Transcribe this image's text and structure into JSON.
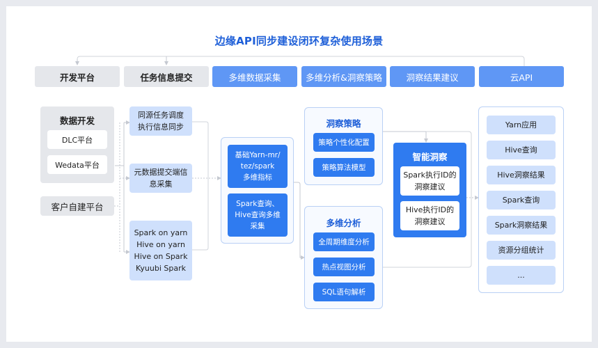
{
  "title": "边缘API同步建设闭环复杂使用场景",
  "headers": [
    {
      "label": "开发平台",
      "style": "gray"
    },
    {
      "label": "任务信息提交",
      "style": "gray"
    },
    {
      "label": "多维数据采集",
      "style": "blue"
    },
    {
      "label": "多维分析&洞察策略",
      "style": "blue"
    },
    {
      "label": "洞察结果建议",
      "style": "blue"
    },
    {
      "label": "云API",
      "style": "blue"
    }
  ],
  "dev_platform": {
    "group_title": "数据开发",
    "items": [
      "DLC平台",
      "Wedata平台"
    ],
    "customer": "客户自建平台"
  },
  "task_submit": {
    "items": [
      {
        "lines": [
          "同源任务调度",
          "执行信息同步"
        ]
      },
      {
        "lines": [
          "元数据提交端信",
          "息采集"
        ]
      },
      {
        "lines": [
          "Spark on yarn",
          "Hive on yarn",
          "Hive on Spark",
          "Kyuubi Spark"
        ]
      }
    ]
  },
  "collection": {
    "items": [
      {
        "lines": [
          "基础Yarn-mr/",
          "tez/spark",
          "多维指标"
        ]
      },
      {
        "lines": [
          "Spark查询、",
          "Hive查询多维",
          "采集"
        ]
      }
    ]
  },
  "strategy": {
    "title": "洞察策略",
    "items": [
      "策略个性化配置",
      "策略算法模型"
    ]
  },
  "analysis": {
    "title": "多维分析",
    "items": [
      "全周期维度分析",
      "热点视图分析",
      "SQL语句解析"
    ]
  },
  "insight": {
    "title": "智能洞察",
    "items": [
      {
        "lines": [
          "Spark执行ID的",
          "洞察建议"
        ]
      },
      {
        "lines": [
          "Hive执行ID的",
          "洞察建议"
        ]
      }
    ]
  },
  "cloud_api": {
    "items": [
      "Yarn应用",
      "Hive查询",
      "Hive洞察结果",
      "Spark查询",
      "Spark洞察结果",
      "资源分组统计",
      "..."
    ]
  },
  "colors": {
    "title": "#1e5fd8",
    "header_blue": "#5f97f5",
    "header_gray": "#e5e7eb",
    "light_blue": "#cfe0fc",
    "primary_blue": "#2f7bf0",
    "panel_border": "#b9d0f5"
  }
}
